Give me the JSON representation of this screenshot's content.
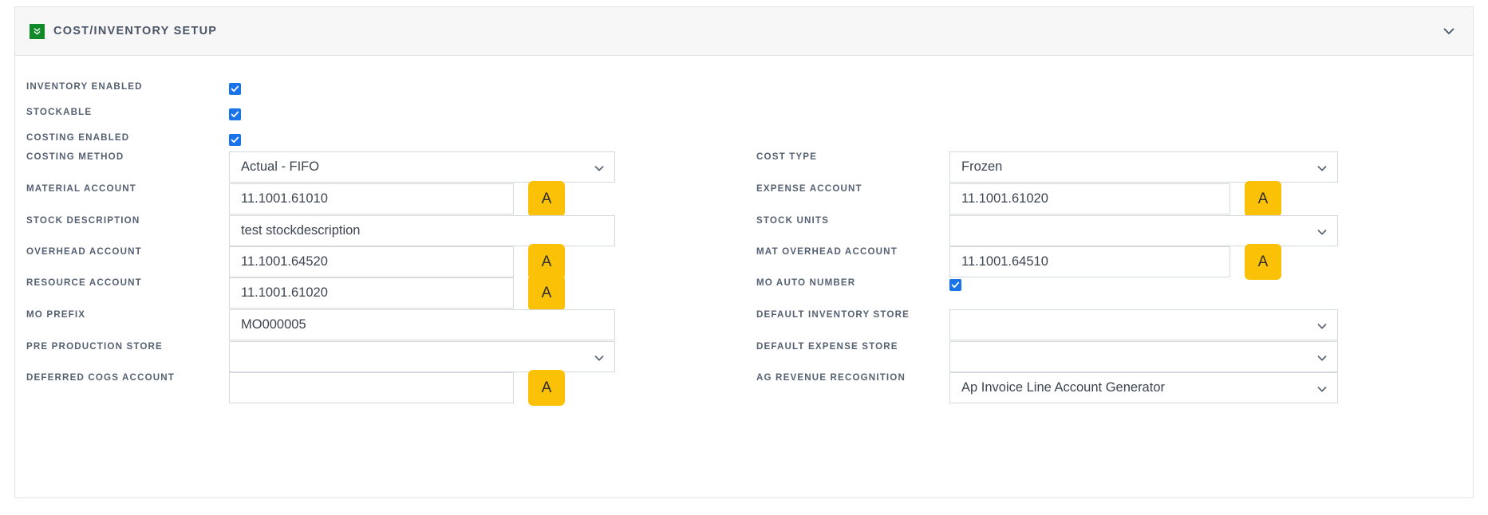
{
  "panel": {
    "title": "COST/INVENTORY SETUP",
    "icon": "collapse-green-icon",
    "collapse_icon": "chevron-down-icon",
    "accent_yellow": "#fbc107",
    "accent_green": "#128a28",
    "accent_blue": "#1a73e8"
  },
  "left_column": [
    {
      "label": "INVENTORY ENABLED",
      "type": "checkbox",
      "checked": true
    },
    {
      "label": "STOCKABLE",
      "type": "checkbox",
      "checked": true
    },
    {
      "label": "COSTING ENABLED",
      "type": "checkbox",
      "checked": true
    },
    {
      "label": "COSTING METHOD",
      "type": "select",
      "value": "Actual - FIFO"
    },
    {
      "label": "MATERIAL ACCOUNT",
      "type": "text",
      "value": "11.1001.61010",
      "button": "A"
    },
    {
      "label": "STOCK DESCRIPTION",
      "type": "text",
      "value": "test stockdescription"
    },
    {
      "label": "OVERHEAD ACCOUNT",
      "type": "text",
      "value": "11.1001.64520",
      "button": "A"
    },
    {
      "label": "RESOURCE ACCOUNT",
      "type": "text",
      "value": "11.1001.61020",
      "button": "A"
    },
    {
      "label": "MO PREFIX",
      "type": "text",
      "value": "MO000005"
    },
    {
      "label": "PRE PRODUCTION STORE",
      "type": "select",
      "value": ""
    },
    {
      "label": "DEFERRED COGS ACCOUNT",
      "type": "text",
      "value": "",
      "button": "A"
    }
  ],
  "right_column": [
    {
      "label": "COST TYPE",
      "type": "select",
      "value": "Frozen"
    },
    {
      "label": "EXPENSE ACCOUNT",
      "type": "text",
      "value": "11.1001.61020",
      "button": "A"
    },
    {
      "label": "STOCK UNITS",
      "type": "select",
      "value": ""
    },
    {
      "label": "MAT OVERHEAD ACCOUNT",
      "type": "text",
      "value": "11.1001.64510",
      "button": "A"
    },
    {
      "label": "MO AUTO NUMBER",
      "type": "checkbox",
      "checked": true
    },
    {
      "label": "DEFAULT INVENTORY STORE",
      "type": "select",
      "value": ""
    },
    {
      "label": "DEFAULT EXPENSE STORE",
      "type": "select",
      "value": ""
    },
    {
      "label": "AG REVENUE RECOGNITION",
      "type": "select",
      "value": "Ap Invoice Line Account Generator"
    }
  ]
}
